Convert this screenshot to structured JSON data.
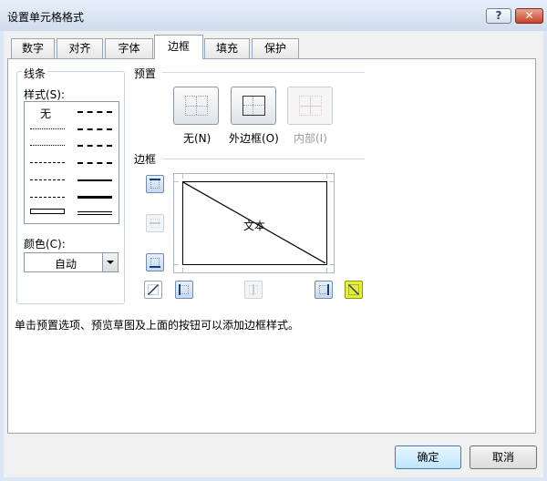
{
  "window": {
    "title": "设置单元格格式",
    "help": "?",
    "close": "✕"
  },
  "tabs": [
    "数字",
    "对齐",
    "字体",
    "边框",
    "填充",
    "保护"
  ],
  "line_section": {
    "title": "线条",
    "style_label": "样式(S):",
    "none_option": "无",
    "color_label": "颜色(C):",
    "color_value": "自动"
  },
  "preset_section": {
    "title": "预置",
    "buttons": [
      "无(N)",
      "外边框(O)",
      "内部(I)"
    ]
  },
  "border_section": {
    "title": "边框",
    "preview_text": "文本"
  },
  "hint": "单击预置选项、预览草图及上面的按钮可以添加边框样式。",
  "footer": {
    "ok": "确定",
    "cancel": "取消"
  },
  "colors": {
    "highlight": "#e6ec3b",
    "window_frame": "#dbe6f4",
    "default_button": "#bee6fd"
  }
}
